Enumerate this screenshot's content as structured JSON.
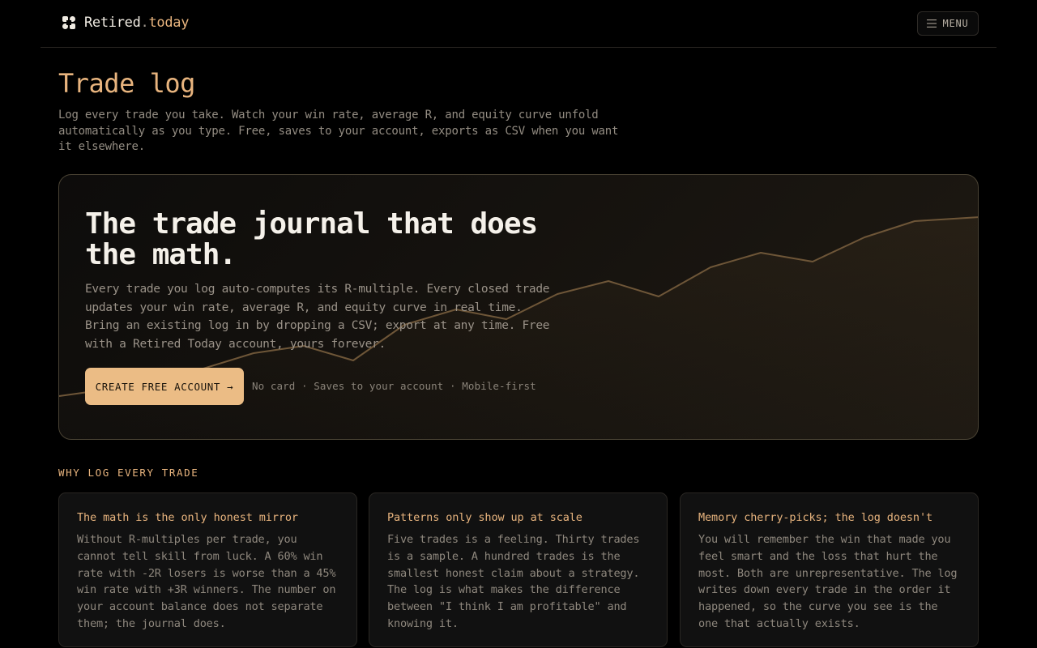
{
  "header": {
    "logo_name": "Retired",
    "logo_dot": ".",
    "logo_tld": "today",
    "menu_label": "MENU"
  },
  "page": {
    "title": "Trade log",
    "subtitle": "Log every trade you take. Watch your win rate, average R, and equity curve unfold automatically as you type. Free, saves to your account, exports as CSV when you want it elsewhere."
  },
  "hero": {
    "title": "The trade journal that does the math.",
    "description": "Every trade you log auto-computes its R-multiple. Every closed trade updates your win rate, average R, and equity curve in real time. Bring an existing log in by dropping a CSV; export at any time. Free with a Retired Today account, yours forever.",
    "cta_label": "CREATE FREE ACCOUNT →",
    "cta_note": "No card · Saves to your account · Mobile-first"
  },
  "why": {
    "label": "WHY LOG EVERY TRADE",
    "cards": [
      {
        "title": "The math is the only honest mirror",
        "body": "Without R-multiples per trade, you cannot tell skill from luck. A 60% win rate with -2R losers is worse than a 45% win rate with +3R winners. The number on your account balance does not separate them; the journal does."
      },
      {
        "title": "Patterns only show up at scale",
        "body": "Five trades is a feeling. Thirty trades is a sample. A hundred trades is the smallest honest claim about a strategy. The log is what makes the difference between \"I think I am profitable\" and knowing it."
      },
      {
        "title": "Memory cherry-picks; the log doesn't",
        "body": "You will remember the win that made you feel smart and the loss that hurt the most. Both are unrepresentative. The log writes down every trade in the order it happened, so the curve you see is the one that actually exists."
      }
    ]
  },
  "colors": {
    "accent": "#e8b47e",
    "cta": "#ebbc85",
    "background": "#000000",
    "curve": "#6e5638"
  },
  "icons": {
    "logo": "logo-mark-icon",
    "menu": "hamburger-icon"
  }
}
